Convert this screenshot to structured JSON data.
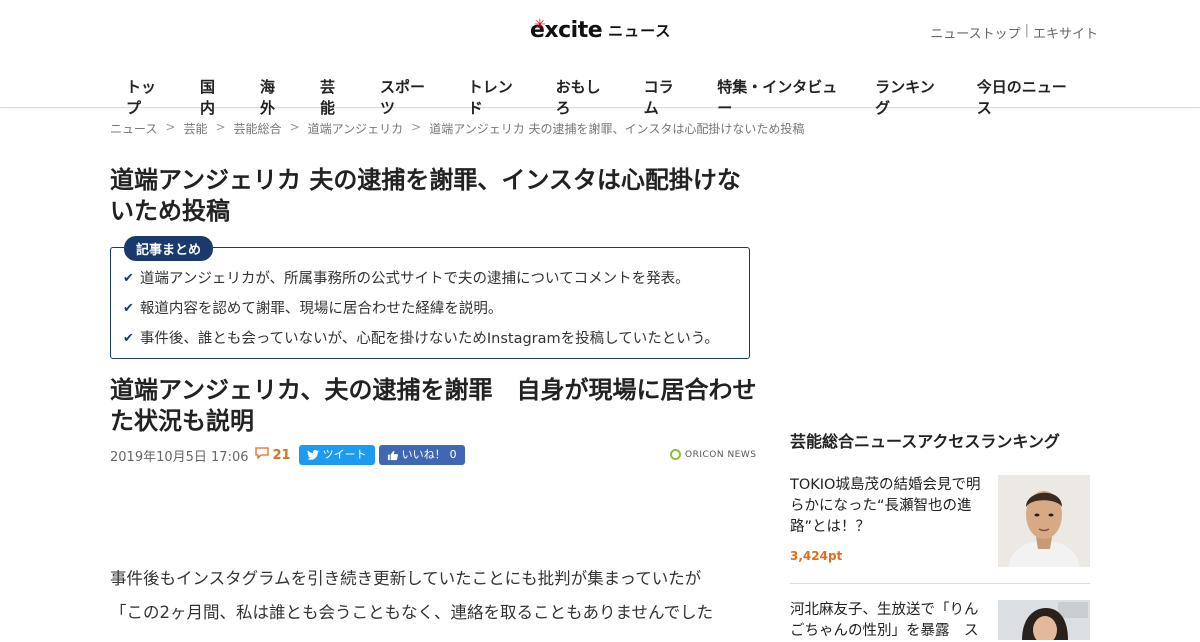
{
  "header": {
    "logo_word": "excite",
    "logo_news": "ニュース",
    "top_links": [
      "ニューストップ",
      "エキサイト"
    ]
  },
  "nav": [
    "トップ",
    "国内",
    "海外",
    "芸能",
    "スポーツ",
    "トレンド",
    "おもしろ",
    "コラム",
    "特集・インタビュー",
    "ランキング",
    "今日のニュース"
  ],
  "breadcrumb": [
    "ニュース",
    "芸能",
    "芸能総合",
    "道端アンジェリカ",
    "道端アンジェリカ 夫の逮捕を謝罪、インスタは心配掛けないため投稿"
  ],
  "article": {
    "headline": "道端アンジェリカ 夫の逮捕を謝罪、インスタは心配掛けないため投稿",
    "summary_label": "記事まとめ",
    "summary": [
      "道端アンジェリカが、所属事務所の公式サイトで夫の逮捕についてコメントを発表。",
      "報道内容を認めて謝罪、現場に居合わせた経緯を説明。",
      "事件後、誰とも会っていないが、心配を掛けないためInstagramを投稿していたという。"
    ],
    "title": "道端アンジェリカ、夫の逮捕を謝罪　自身が現場に居合わせた状況も説明",
    "date": "2019年10月5日 17:06",
    "comment_count": "21",
    "tweet_label": "ツイート",
    "like_label": "いいね！",
    "like_count": "0",
    "source": "ORICON NEWS",
    "body": [
      "事件後もインスタグラムを引き続き更新していたことにも批判が集まっていたが",
      "「この2ヶ月間、私は誰とも会うこともなく、連絡を取ることもありませんでした"
    ]
  },
  "sidebar": {
    "heading": "芸能総合ニュースアクセスランキング",
    "items": [
      {
        "title": "TOKIO城島茂の結婚会見で明らかになった“長瀬智也の進路”とは！？",
        "points": "3,424pt"
      },
      {
        "title": "河北麻友子、生放送で「りんごちゃんの性別」を暴露　ス",
        "points": ""
      }
    ]
  },
  "colors": {
    "accent_navy": "#1a3a6e",
    "points_orange": "#e26d1e",
    "twitter_blue": "#1d9bf0",
    "facebook_blue": "#4267b2",
    "logo_red": "#e60012"
  }
}
